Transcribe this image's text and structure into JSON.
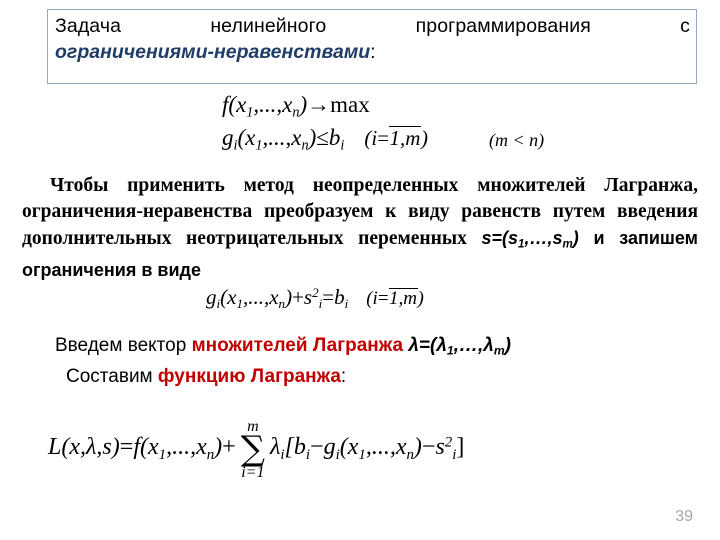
{
  "slide": {
    "page_number": "39",
    "title": {
      "line1": "Задача нелинейного программирования с",
      "line2_emphasis": "ограничениями-неравенствами",
      "line2_colon": ":",
      "emphasis_color": "#1f3d66",
      "border_color": "#95a8c4"
    },
    "equations": {
      "objective": {
        "f": "f",
        "args_open": "(",
        "x1": "x",
        "x1_sub": "1",
        "ellipsis": ",...,",
        "xn": "x",
        "xn_sub": "n",
        "args_close": ")",
        "arrow": "→",
        "max": "max"
      },
      "constraint_ineq": {
        "g": "g",
        "g_sub": "i",
        "args_open": "(",
        "x1": "x",
        "x1_sub": "1",
        "ellipsis": ",...,",
        "xn": "x",
        "xn_sub": "n",
        "args_close": ")",
        "rel": "≤",
        "b": "b",
        "b_sub": "i",
        "range_open": "(",
        "range_i": "i",
        "range_eq": "=",
        "range_bar": "1,m",
        "range_close": ")"
      },
      "mn_note": "(m < n)",
      "constraint_eq": {
        "g": "g",
        "g_sub": "i",
        "args_open": "(",
        "x1": "x",
        "x1_sub": "1",
        "ellipsis": ",...,",
        "xn": "x",
        "xn_sub": "n",
        "args_close": ")",
        "plus": "+",
        "s": "s",
        "s_sub": "i",
        "s_sup": "2",
        "rel": "=",
        "b": "b",
        "b_sub": "i",
        "range_open": "(",
        "range_i": "i",
        "range_eq": "=",
        "range_bar": "1,m",
        "range_close": ")"
      },
      "lagrangian": {
        "L": "L",
        "L_open": "(",
        "L_x": "x",
        "L_c1": ",",
        "L_lambda": "λ",
        "L_c2": ",",
        "L_s": "s",
        "L_close": ")",
        "eq": "=",
        "f": "f",
        "f_open": "(",
        "x1": "x",
        "x1_sub": "1",
        "ellipsis": ",...,",
        "xn": "x",
        "xn_sub": "n",
        "f_close": ")",
        "plus": "+",
        "sum_upper": "m",
        "sum_symbol": "∑",
        "sum_lower": "i=1",
        "lambda": "λ",
        "lambda_sub": "i",
        "bracket_open": "[",
        "b": "b",
        "b_sub": "i",
        "minus1": "−",
        "g": "g",
        "g_sub": "i",
        "g_open": "(",
        "g_x1": "x",
        "g_x1_sub": "1",
        "g_ellipsis": ",...,",
        "g_xn": "x",
        "g_xn_sub": "n",
        "g_close": ")",
        "minus2": "−",
        "s": "s",
        "s_sub": "i",
        "s_sup": "2",
        "bracket_close": "]"
      }
    },
    "paragraph": {
      "part1": "Чтобы применить метод неопределенных множителей Лагранжа, ограничения-неравенства преобразуем к виду равенств путем введения дополнительных неотрицательных переменных ",
      "s_vector": {
        "s": "s",
        "eq": "=(",
        "s1": "s",
        "s1_sub": "1",
        "ellipsis": ",…,",
        "sm": "s",
        "sm_sub": "m",
        "close": ")"
      },
      "part2": " и запишем ограничения в виде"
    },
    "lambda_line": {
      "prefix": "Введем вектор ",
      "red_text": "множителей Лагранжа",
      "space": " ",
      "vector": {
        "lambda": "λ",
        "eq": "=(",
        "l1": "λ",
        "l1_sub": "1",
        "ellipsis": ",…,",
        "lm": "λ",
        "lm_sub": "m",
        "close": ")"
      },
      "red_color": "#c00000"
    },
    "lagrange_func_line": {
      "prefix": "Составим ",
      "red_text": "функцию Лагранжа",
      "suffix": ":"
    }
  }
}
